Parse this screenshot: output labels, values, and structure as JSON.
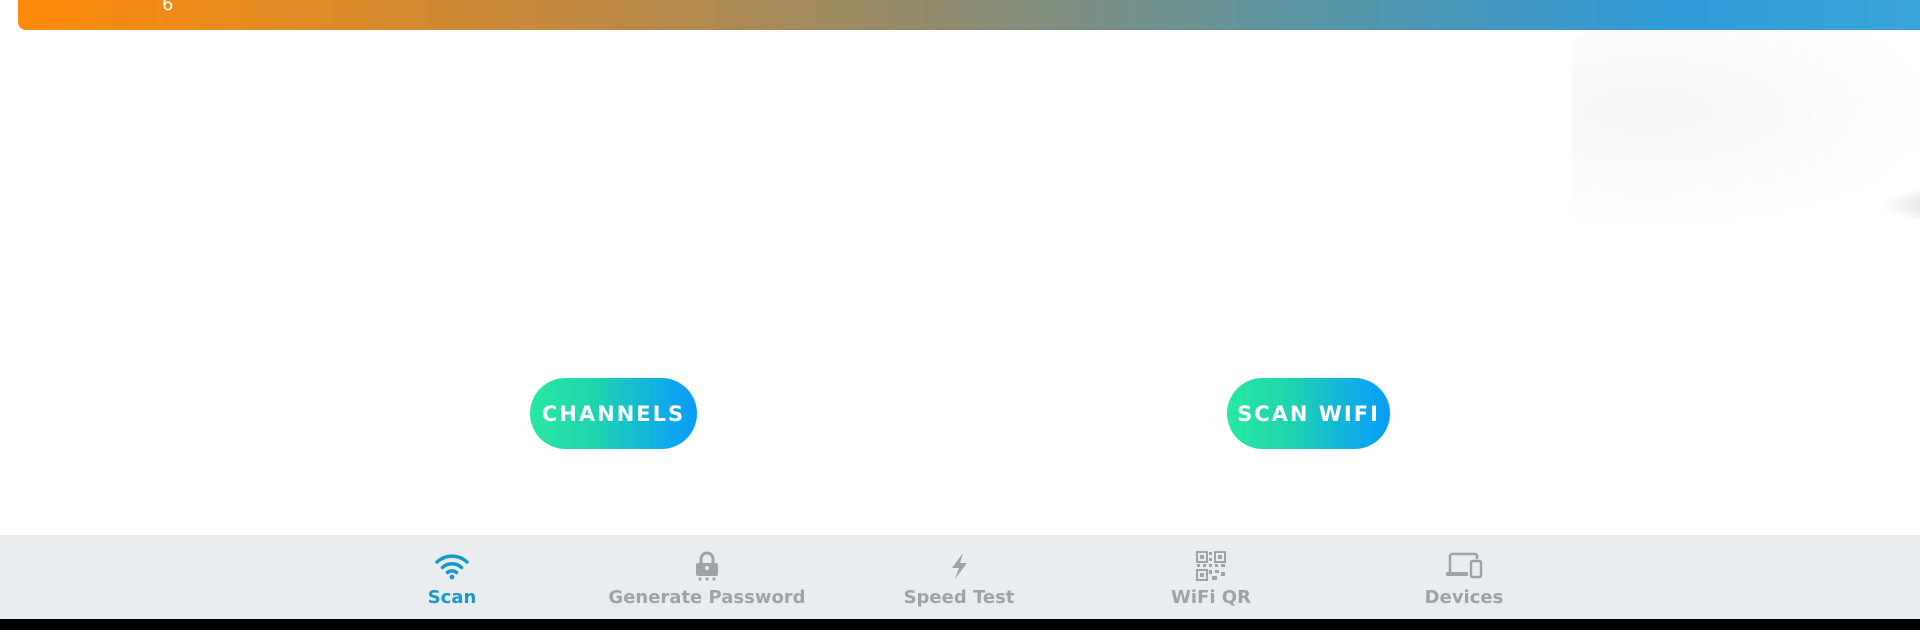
{
  "banner": {
    "number": "6"
  },
  "actions": {
    "channels_label": "CHANNELS",
    "scan_wifi_label": "SCAN WIFI"
  },
  "bottom_nav": {
    "items": [
      {
        "label": "Scan",
        "icon": "wifi-icon",
        "active": true
      },
      {
        "label": "Generate Password",
        "icon": "lock-icon",
        "active": false
      },
      {
        "label": "Speed Test",
        "icon": "lightning-icon",
        "active": false
      },
      {
        "label": "WiFi QR",
        "icon": "qr-code-icon",
        "active": false
      },
      {
        "label": "Devices",
        "icon": "devices-icon",
        "active": false
      }
    ]
  },
  "colors": {
    "active_tab": "#1a98c9",
    "inactive_tab": "#a0a3a6",
    "button_gradient_start": "#28e8a0",
    "button_gradient_end": "#0a9cf5",
    "nav_background": "#e9edf0"
  }
}
